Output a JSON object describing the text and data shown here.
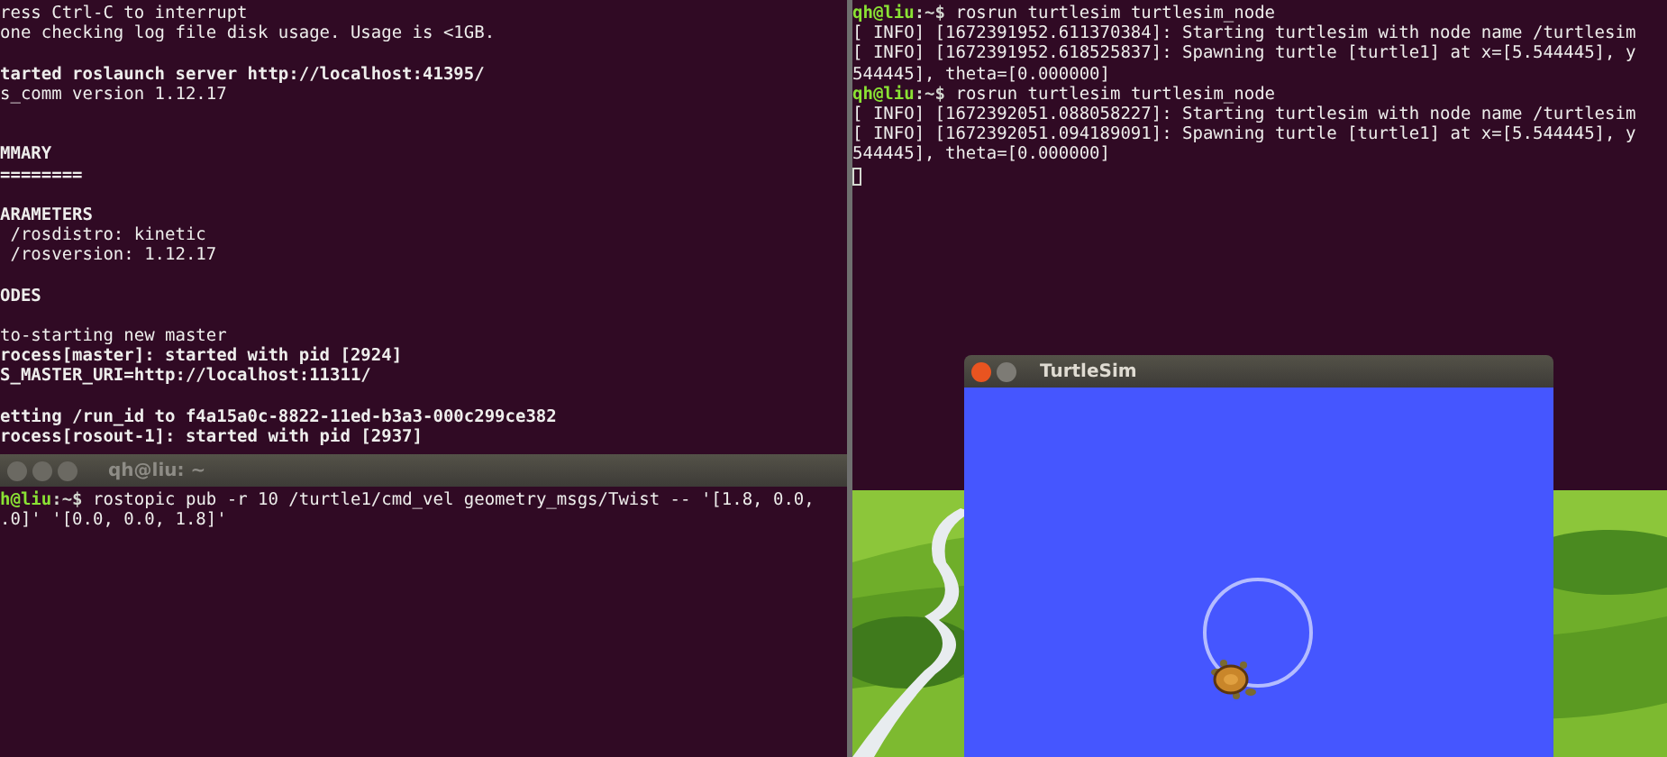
{
  "left_terminal": {
    "lines": [
      {
        "kind": "text",
        "text": "ress Ctrl-C to interrupt",
        "bold": false
      },
      {
        "kind": "text",
        "text": "one checking log file disk usage. Usage is <1GB.",
        "bold": false
      },
      {
        "kind": "blank"
      },
      {
        "kind": "text",
        "text": "tarted roslaunch server http://localhost:41395/",
        "bold": true
      },
      {
        "kind": "text",
        "text": "s_comm version 1.12.17",
        "bold": false
      },
      {
        "kind": "blank"
      },
      {
        "kind": "blank"
      },
      {
        "kind": "text",
        "text": "MMARY",
        "bold": true
      },
      {
        "kind": "text",
        "text": "========",
        "bold": true
      },
      {
        "kind": "blank"
      },
      {
        "kind": "text",
        "text": "ARAMETERS",
        "bold": true
      },
      {
        "kind": "text",
        "text": " /rosdistro: kinetic",
        "bold": false
      },
      {
        "kind": "text",
        "text": " /rosversion: 1.12.17",
        "bold": false
      },
      {
        "kind": "blank"
      },
      {
        "kind": "text",
        "text": "ODES",
        "bold": true
      },
      {
        "kind": "blank"
      },
      {
        "kind": "text",
        "text": "to-starting new master",
        "bold": false
      },
      {
        "kind": "text",
        "text": "rocess[master]: started with pid [2924]",
        "bold": true
      },
      {
        "kind": "text",
        "text": "S_MASTER_URI=http://localhost:11311/",
        "bold": true
      },
      {
        "kind": "blank"
      },
      {
        "kind": "text",
        "text": "etting /run_id to f4a15a0c-8822-11ed-b3a3-000c299ce382",
        "bold": true
      },
      {
        "kind": "text",
        "text": "rocess[rosout-1]: started with pid [2937]",
        "bold": true
      }
    ]
  },
  "bottom_terminal": {
    "title": "qh@liu: ~",
    "lines": [
      {
        "kind": "prompt",
        "user": "h@liu",
        "sign": ":~$",
        "command": " rostopic pub -r 10 /turtle1/cmd_vel geometry_msgs/Twist -- '[1.8, 0.0,"
      },
      {
        "kind": "text",
        "text": ".0]' '[0.0, 0.0, 1.8]'",
        "bold": false
      }
    ]
  },
  "right_terminal": {
    "lines": [
      {
        "kind": "prompt",
        "user": "qh@liu",
        "sign": ":~$",
        "command": " rosrun turtlesim turtlesim_node"
      },
      {
        "kind": "text",
        "text": "[ INFO] [1672391952.611370384]: Starting turtlesim with node name /turtlesim",
        "bold": false
      },
      {
        "kind": "text",
        "text": "[ INFO] [1672391952.618525837]: Spawning turtle [turtle1] at x=[5.544445], y",
        "bold": false
      },
      {
        "kind": "text",
        "text": "544445], theta=[0.000000]",
        "bold": false
      },
      {
        "kind": "prompt",
        "user": "qh@liu",
        "sign": ":~$",
        "command": " rosrun turtlesim turtlesim_node"
      },
      {
        "kind": "text",
        "text": "[ INFO] [1672392051.088058227]: Starting turtlesim with node name /turtlesim",
        "bold": false
      },
      {
        "kind": "text",
        "text": "[ INFO] [1672392051.094189091]: Spawning turtle [turtle1] at x=[5.544445], y",
        "bold": false
      },
      {
        "kind": "text",
        "text": "544445], theta=[0.000000]",
        "bold": false
      },
      {
        "kind": "cursor"
      }
    ]
  },
  "turtlesim": {
    "title": "TurtleSim"
  }
}
